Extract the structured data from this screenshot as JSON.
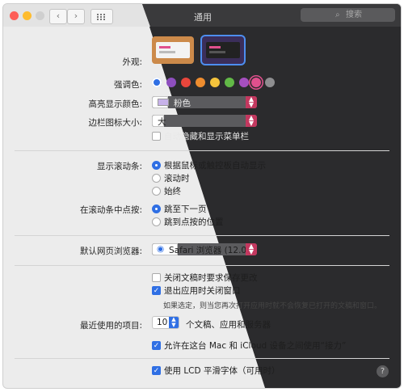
{
  "window": {
    "title": "通用",
    "search_placeholder": "搜索"
  },
  "icons": {
    "back": "chevron-left-icon",
    "forward": "chevron-right-icon",
    "grid": "grid-icon",
    "search": "search-icon",
    "help": "help-icon"
  },
  "appearance": {
    "label": "外观:"
  },
  "accent": {
    "label": "强调色:",
    "colors": [
      "#2f6fe4",
      "#8e4fbf",
      "#e0508d",
      "#e8463c",
      "#ef8d2f",
      "#f4c33c",
      "#62b947",
      "#a54fbf",
      "#e0508d",
      "#8e8e90"
    ]
  },
  "highlight": {
    "label": "高亮显示颜色:",
    "value": "粉色"
  },
  "sidebar_icon": {
    "label": "边栏图标大小:",
    "value": "大"
  },
  "menubar": {
    "label": "自动隐藏和显示菜单栏"
  },
  "scrollbars": {
    "label": "显示滚动条:",
    "options": [
      "根据鼠标或触控板自动显示",
      "滚动时",
      "始终"
    ]
  },
  "scroll_click": {
    "label": "在滚动条中点按:",
    "options": [
      "跳至下一页",
      "跳到点按的位置"
    ]
  },
  "browser": {
    "label": "默认网页浏览器:",
    "value": "Safari 浏览器 (12.0)"
  },
  "docs": {
    "ask_keep": "关闭文稿时要求保存更改",
    "close_windows": "退出应用时关闭窗口",
    "note": "如果选定，则当您再次打开应用时就不会恢复已打开的文稿和窗口。"
  },
  "recent": {
    "label": "最近使用的项目:",
    "value": "10",
    "suffix": "个文稿、应用和服务器"
  },
  "handoff": {
    "label": "允许在这台 Mac 和 iCloud 设备之间使用“接力”"
  },
  "lcd": {
    "label": "使用 LCD 平滑字体（可用时）"
  }
}
